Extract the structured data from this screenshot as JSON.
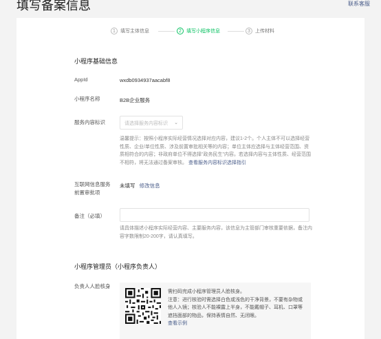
{
  "header": {
    "title": "填写备案信息",
    "contact_label": "联系客服"
  },
  "steps": [
    {
      "num": "1",
      "label": "填写主体信息",
      "active": false
    },
    {
      "num": "2",
      "label": "填写小程序信息",
      "active": true
    },
    {
      "num": "3",
      "label": "上传材料",
      "active": false
    }
  ],
  "basic": {
    "section_title": "小程序基础信息",
    "appid_label": "AppId",
    "appid_value": "wxdb0934937aacabf8",
    "name_label": "小程序名称",
    "name_value": "B2B企业服务",
    "service_label": "服务内容标识",
    "service_placeholder": "请选择服务内容标识",
    "service_hint": "温馨提示：按照小程序实际经营情况选择对应内容，建议1-2个。个人主体不可以选择经营性质、企业/单位性质、涉及前置审批相关等的内容；单位主体应选择与主体经营范围、资质相符合的内容；非政府单位不得选择\"政务民生\"内容。若选择内容与主体性质、经营范围不相符，将无法通过备案审核。",
    "service_hint_link": "查看服务内容标识选择指引",
    "permit_label_1": "互联网信息服务",
    "permit_label_2": "前置审批项",
    "permit_value": "未填写",
    "permit_edit": "修改信息",
    "remark_label": "备注（必填）",
    "remark_hint": "请具体描述小程序实际经营内容、主要服务内容，该信息为主管部门审核重要依据，备注内容字数限制20-200字，请认真填写。"
  },
  "admin": {
    "section_title": "小程序管理员（小程序负责人）",
    "face_label": "负责人人脸核身",
    "qr_title": "需扫码完成小程序管理员人脸核身。",
    "qr_note": "注意：进行核验时需选择白色或浅色的干净背景，不要有杂物或他人入镜；核验人不能裸露上半身，不能戴帽子、耳机、口罩等遮挡面部的物品，保持表情自然、无闭眼。",
    "qr_link": "查看示例"
  }
}
